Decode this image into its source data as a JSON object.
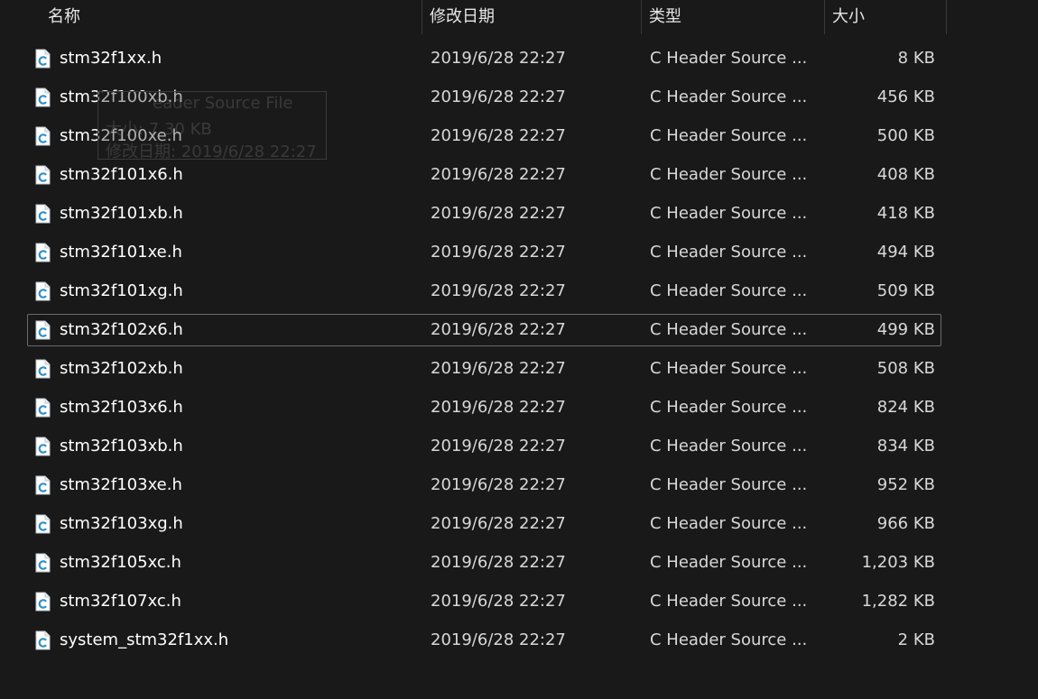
{
  "columns": {
    "name": "名称",
    "date": "修改日期",
    "type": "类型",
    "size": "大小"
  },
  "files": [
    {
      "name": "stm32f1xx.h",
      "date": "2019/6/28 22:27",
      "type": "C Header Source ...",
      "size": "8 KB"
    },
    {
      "name": "stm32f100xb.h",
      "date": "2019/6/28 22:27",
      "type": "C Header Source ...",
      "size": "456 KB"
    },
    {
      "name": "stm32f100xe.h",
      "date": "2019/6/28 22:27",
      "type": "C Header Source ...",
      "size": "500 KB"
    },
    {
      "name": "stm32f101x6.h",
      "date": "2019/6/28 22:27",
      "type": "C Header Source ...",
      "size": "408 KB"
    },
    {
      "name": "stm32f101xb.h",
      "date": "2019/6/28 22:27",
      "type": "C Header Source ...",
      "size": "418 KB"
    },
    {
      "name": "stm32f101xe.h",
      "date": "2019/6/28 22:27",
      "type": "C Header Source ...",
      "size": "494 KB"
    },
    {
      "name": "stm32f101xg.h",
      "date": "2019/6/28 22:27",
      "type": "C Header Source ...",
      "size": "509 KB"
    },
    {
      "name": "stm32f102x6.h",
      "date": "2019/6/28 22:27",
      "type": "C Header Source ...",
      "size": "499 KB",
      "focused": true
    },
    {
      "name": "stm32f102xb.h",
      "date": "2019/6/28 22:27",
      "type": "C Header Source ...",
      "size": "508 KB"
    },
    {
      "name": "stm32f103x6.h",
      "date": "2019/6/28 22:27",
      "type": "C Header Source ...",
      "size": "824 KB"
    },
    {
      "name": "stm32f103xb.h",
      "date": "2019/6/28 22:27",
      "type": "C Header Source ...",
      "size": "834 KB"
    },
    {
      "name": "stm32f103xe.h",
      "date": "2019/6/28 22:27",
      "type": "C Header Source ...",
      "size": "952 KB"
    },
    {
      "name": "stm32f103xg.h",
      "date": "2019/6/28 22:27",
      "type": "C Header Source ...",
      "size": "966 KB"
    },
    {
      "name": "stm32f105xc.h",
      "date": "2019/6/28 22:27",
      "type": "C Header Source ...",
      "size": "1,203 KB"
    },
    {
      "name": "stm32f107xc.h",
      "date": "2019/6/28 22:27",
      "type": "C Header Source ...",
      "size": "1,282 KB"
    },
    {
      "name": "system_stm32f1xx.h",
      "date": "2019/6/28 22:27",
      "type": "C Header Source ...",
      "size": "2 KB"
    }
  ],
  "tooltip": {
    "type_line": "eader Source File",
    "size_line": "大小: 7.30 KB",
    "date_line": "修改日期: 2019/6/28 22:27"
  },
  "icon": "c-header-file-icon",
  "colors": {
    "background": "#191919",
    "icon_accent": "#2f8fc9",
    "focus_border": "#6a6a6a"
  }
}
